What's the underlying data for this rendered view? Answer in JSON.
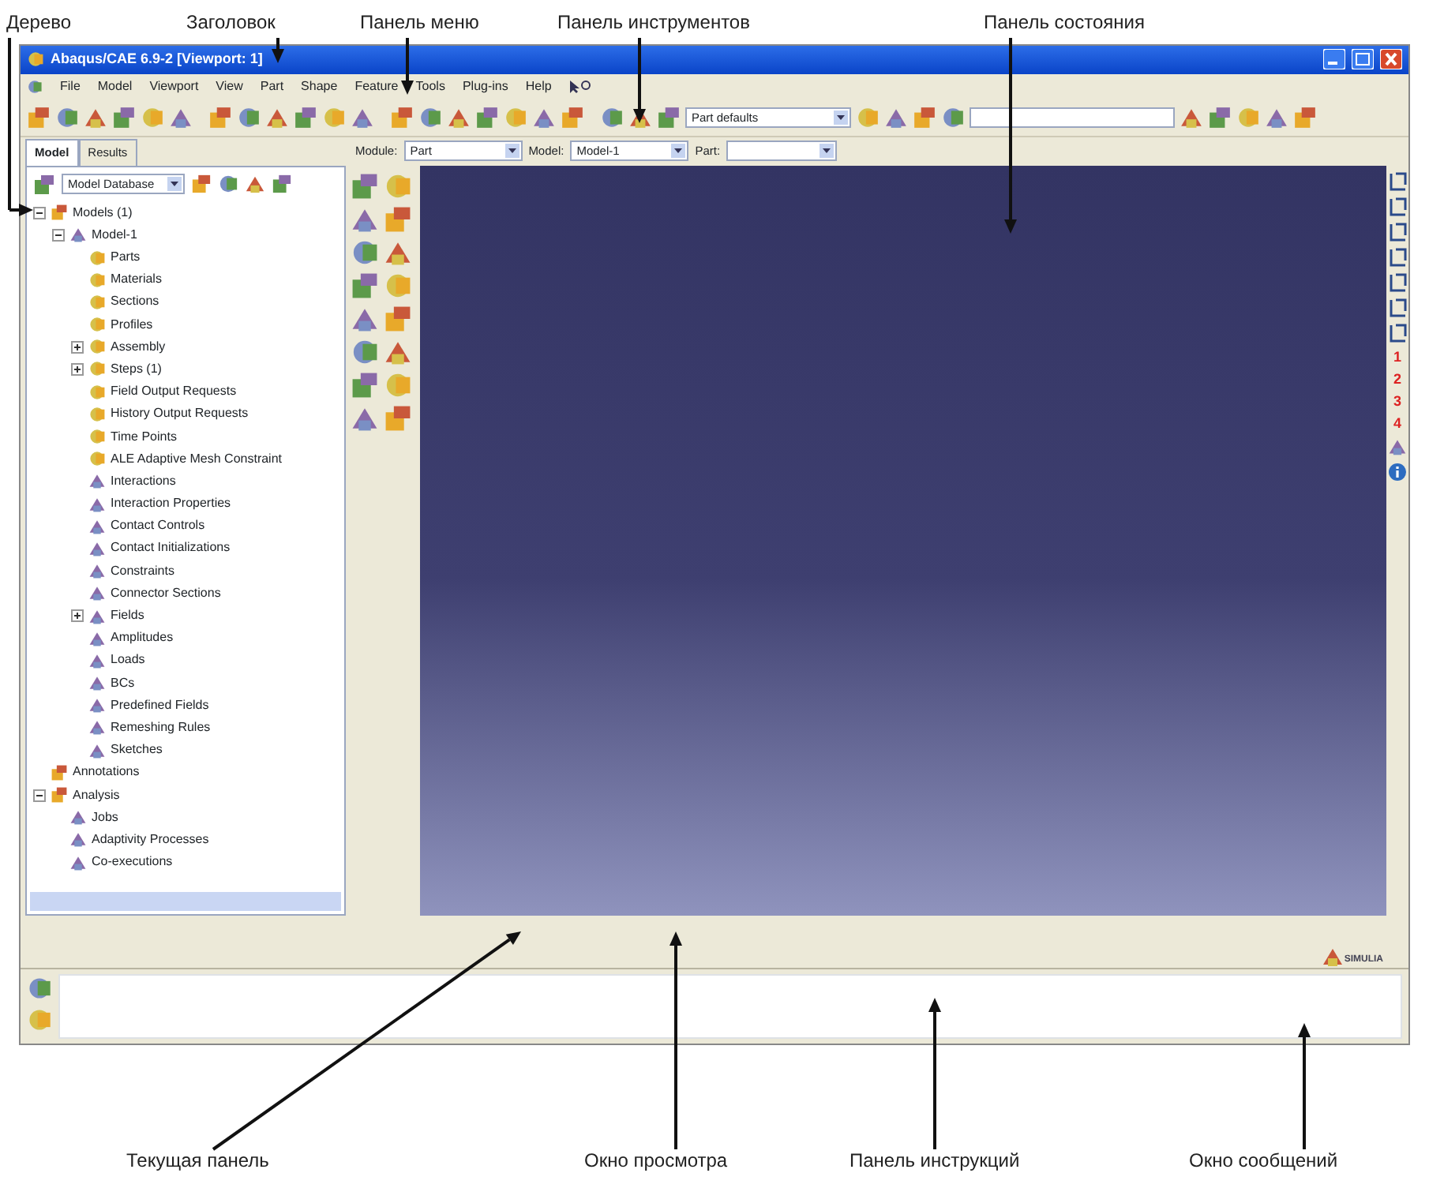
{
  "labels_top": [
    "Дерево",
    "Заголовок",
    "Панель меню",
    "Панель инструментов",
    "Панель состояния"
  ],
  "window": {
    "title": "Abaqus/CAE 6.9-2 [Viewport: 1]"
  },
  "menu": [
    "File",
    "Model",
    "Viewport",
    "View",
    "Part",
    "Shape",
    "Feature",
    "Tools",
    "Plug-ins",
    "Help"
  ],
  "toolbar": {
    "render_style": "Part defaults"
  },
  "model_tree": {
    "tabs": [
      {
        "label": "Model",
        "selected": true
      },
      {
        "label": "Results",
        "selected": false
      }
    ],
    "database": "Model Database",
    "items": [
      {
        "label": "Models (1)",
        "expanded": true,
        "children": [
          {
            "label": "Model-1",
            "expanded": true,
            "children": [
              {
                "label": "Parts"
              },
              {
                "label": "Materials"
              },
              {
                "label": "Sections"
              },
              {
                "label": "Profiles"
              },
              {
                "label": "Assembly",
                "expanded": false
              },
              {
                "label": "Steps (1)",
                "expanded": false
              },
              {
                "label": "Field Output Requests"
              },
              {
                "label": "History Output Requests"
              },
              {
                "label": "Time Points"
              },
              {
                "label": "ALE Adaptive Mesh Constraint"
              },
              {
                "label": "Interactions"
              },
              {
                "label": "Interaction Properties"
              },
              {
                "label": "Contact Controls"
              },
              {
                "label": "Contact Initializations"
              },
              {
                "label": "Constraints"
              },
              {
                "label": "Connector Sections"
              },
              {
                "label": "Fields",
                "expanded": false
              },
              {
                "label": "Amplitudes"
              },
              {
                "label": "Loads"
              },
              {
                "label": "BCs"
              },
              {
                "label": "Predefined Fields"
              },
              {
                "label": "Remeshing Rules"
              },
              {
                "label": "Sketches"
              }
            ]
          }
        ]
      },
      {
        "label": "Annotations"
      },
      {
        "label": "Analysis",
        "expanded": true,
        "children": [
          {
            "label": "Jobs"
          },
          {
            "label": "Adaptivity Processes"
          },
          {
            "label": "Co-executions"
          }
        ]
      }
    ]
  },
  "context_bar": {
    "module_label": "Module:",
    "module": "Part",
    "model_label": "Model:",
    "model": "Model-1",
    "part_label": "Part:"
  },
  "view_toolbar": {
    "numbers": [
      "1",
      "2",
      "3",
      "4"
    ]
  },
  "logo": "SIMULIA",
  "labels_bottom": [
    "Текущая панель",
    "Окно просмотра",
    "Панель инструкций",
    "Окно сообщений"
  ]
}
